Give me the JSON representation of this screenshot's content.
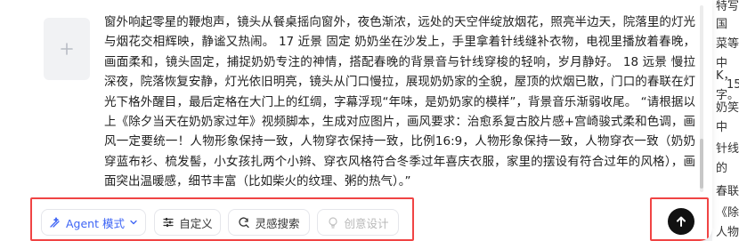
{
  "background_text": [
    "特写",
    "国",
    "菜等家",
    "中",
    "K，",
    "字。",
    "15",
    "奶笑着",
    "中",
    "针线缝",
    "的",
    "春联在",
    "《除",
    "人物"
  ],
  "prompt": {
    "text": "窗外响起零星的鞭炮声，镜头从餐桌摇向窗外，夜色渐浓，远处的天空伴绽放烟花，照亮半边天，院落里的灯光与烟花交相辉映，静谧又热闹。 17 近景 固定 奶奶坐在沙发上，手里拿着针线缝补衣物，电视里播放着春晚，画面柔和，镜头固定，捕捉奶奶专注的神情，搭配春晚的背景音与针线穿梭的轻响，岁月静好。 18 远景 慢拉 深夜，院落恢复安静，灯光依旧明亮，镜头从门口慢拉，展现奶奶家的全貌，屋顶的炊烟已散，门口的春联在灯光下格外醒目，最后定格在大门上的红绸，字幕浮现“年味，是奶奶家的模样”，背景音乐渐弱收尾。 “请根据以上《除夕当天在奶奶家过年》视频脚本，生成对应图片，画风要求：治愈系复古胶片感+宫崎骏式柔和色调，画风一定要统一！人物形象保持一致，人物穿衣保持一致，比例16:9，人物形象保持一致，人物穿衣一致（奶奶穿蓝布衫、梳发髻，小女孩扎两个小辫、穿衣风格符合冬季过年喜庆衣服，家里的摆设有符合过年的风格），画面突出温暖感，细节丰富（比如柴火的纹理、粥的热气）。”"
  },
  "toolbar": {
    "agent_mode_label": "Agent 模式",
    "custom_label": "自定义",
    "inspiration_search_label": "灵感搜索",
    "creative_design_label": "创意设计"
  },
  "colors": {
    "accent": "#3d64f5",
    "highlight_border": "#f04444",
    "send_button": "#111111"
  },
  "icons": {
    "add": "plus-icon",
    "agent": "agent-sparkle-icon",
    "dropdown": "chevron-down-icon",
    "custom": "sliders-icon",
    "inspire": "refresh-search-icon",
    "design": "bulb-icon",
    "send": "arrow-up-icon"
  }
}
